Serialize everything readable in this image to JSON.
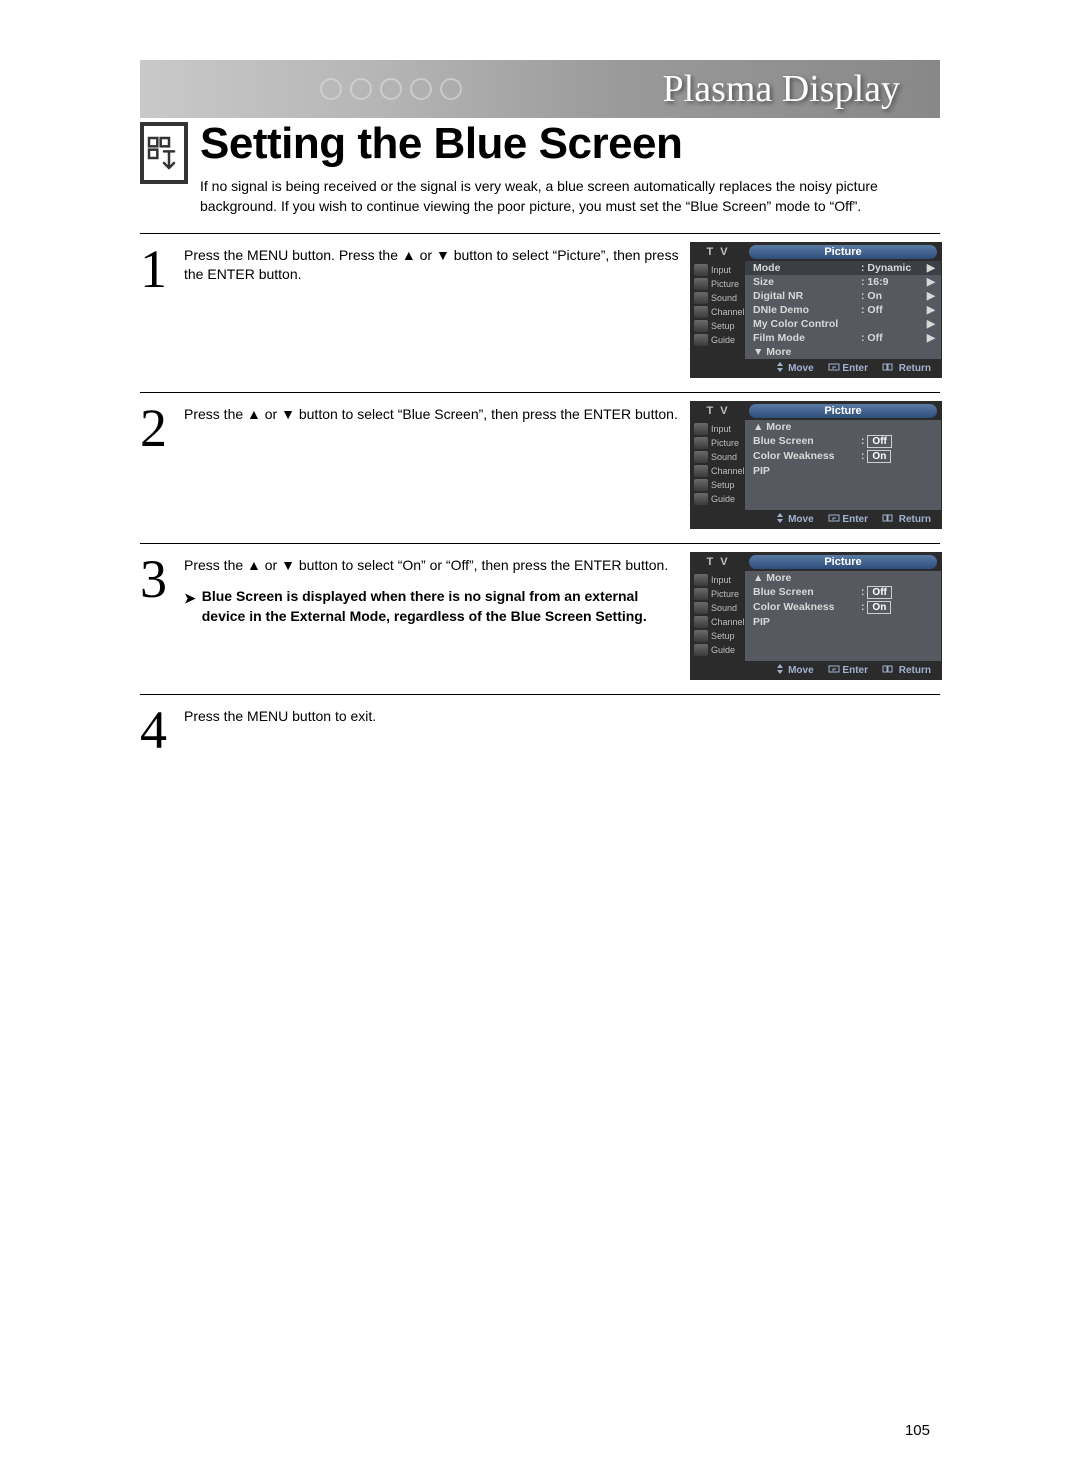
{
  "banner": "Plasma Display",
  "page_title": "Setting the Blue Screen",
  "intro": "If no signal is being received or the signal is very weak, a blue screen automatically replaces the noisy picture background. If you wish to continue viewing the poor picture, you must set the “Blue Screen” mode to “Off”.",
  "steps": [
    {
      "num": "1",
      "text": "Press the MENU button. Press the ▲ or ▼ button to select “Picture”, then press the ENTER button."
    },
    {
      "num": "2",
      "text": "Press the ▲ or ▼ button to select “Blue Screen”, then press the ENTER button."
    },
    {
      "num": "3",
      "text": "Press the ▲ or ▼ button to select “On” or “Off”, then press the ENTER button.",
      "note": "Blue Screen is displayed when there is no signal from an external device in the External Mode, regardless of the Blue Screen Setting."
    },
    {
      "num": "4",
      "text": "Press the MENU button to exit."
    }
  ],
  "osd": {
    "tv_label": "T V",
    "pill": "Picture",
    "side": [
      "Input",
      "Picture",
      "Sound",
      "Channel",
      "Setup",
      "Guide"
    ],
    "footer": {
      "move": "Move",
      "enter": "Enter",
      "return": "Return"
    },
    "screens": [
      {
        "rows": [
          {
            "label": "Mode",
            "val": ": Dynamic",
            "arrow": true,
            "hl": true,
            "box_val": false
          },
          {
            "label": "Size",
            "val": ": 16:9",
            "arrow": true
          },
          {
            "label": "Digital NR",
            "val": ": On",
            "arrow": true
          },
          {
            "label": "DNIe Demo",
            "val": ": Off",
            "arrow": true
          },
          {
            "label": "My Color Control",
            "val": "",
            "arrow": true
          },
          {
            "label": "Film Mode",
            "val": ": Off",
            "arrow": true
          },
          {
            "label": "▼ More",
            "val": "",
            "arrow": false
          }
        ]
      },
      {
        "rows": [
          {
            "label": "▲ More",
            "val": "",
            "arrow": false
          },
          {
            "label": "Blue Screen",
            "val": "Off",
            "arrow": false,
            "box_val": true,
            "prefix": ": "
          },
          {
            "label": "Color Weakness",
            "val": "On",
            "arrow": false,
            "box_val": true,
            "prefix": ": "
          },
          {
            "label": "PIP",
            "val": "",
            "arrow": false
          }
        ]
      },
      {
        "rows": [
          {
            "label": "▲ More",
            "val": "",
            "arrow": false
          },
          {
            "label": "Blue Screen",
            "val": "Off",
            "arrow": false,
            "box_val": true,
            "prefix": ": "
          },
          {
            "label": "Color Weakness",
            "val": "On",
            "arrow": false,
            "box_val": true,
            "prefix": ": "
          },
          {
            "label": "PIP",
            "val": "",
            "arrow": false
          }
        ]
      }
    ]
  },
  "page_number": "105"
}
